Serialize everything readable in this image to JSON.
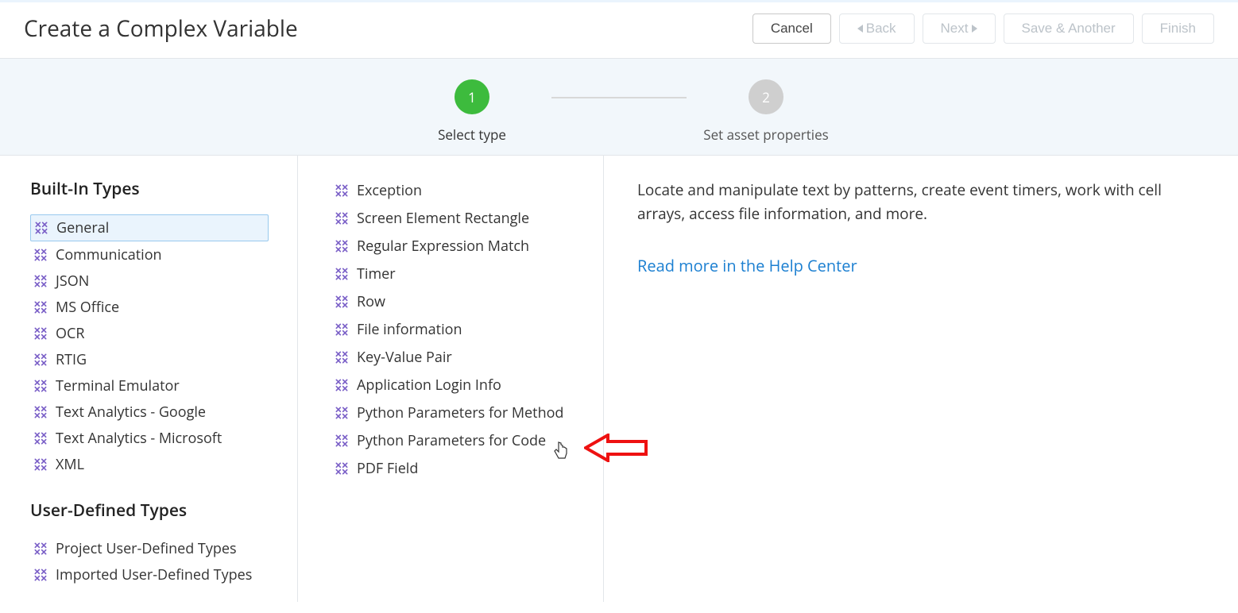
{
  "title": "Create a Complex Variable",
  "buttons": {
    "cancel": "Cancel",
    "back": "Back",
    "next": "Next",
    "saveAnother": "Save & Another",
    "finish": "Finish"
  },
  "steps": {
    "s1": {
      "num": "1",
      "label": "Select type"
    },
    "s2": {
      "num": "2",
      "label": "Set asset properties"
    }
  },
  "cats": {
    "header1": "Built-In Types",
    "header2": "User-Defined Types",
    "builtin": [
      "General",
      "Communication",
      "JSON",
      "MS Office",
      "OCR",
      "RTIG",
      "Terminal Emulator",
      "Text Analytics - Google",
      "Text Analytics - Microsoft",
      "XML"
    ],
    "user": [
      "Project User-Defined Types",
      "Imported User-Defined Types"
    ]
  },
  "types": [
    "Exception",
    "Screen Element Rectangle",
    "Regular Expression Match",
    "Timer",
    "Row",
    "File information",
    "Key-Value Pair",
    "Application Login Info",
    "Python Parameters for Method",
    "Python Parameters for Code",
    "PDF Field"
  ],
  "rightPane": {
    "description": "Locate and manipulate text by patterns, create event timers, work with cell arrays, access file information, and more.",
    "helpLink": "Read more in the Help Center"
  }
}
